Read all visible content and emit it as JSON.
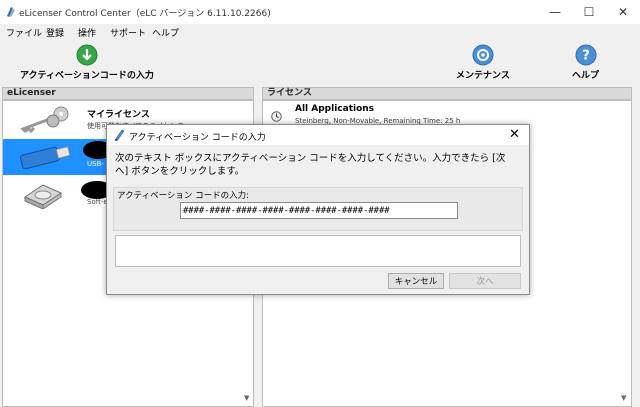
{
  "window": {
    "title": "eLicenser Control Center（eLC バージョン 6.11.10.2266)",
    "min": "—",
    "max": "☐",
    "close": "✕"
  },
  "menu": [
    "ファイル",
    "登録",
    "操作",
    "サポート",
    "ヘルプ"
  ],
  "toolbar": {
    "activation_label": "アクティベーションコードの入力",
    "maintenance_label": "メンテナンス",
    "help_label": "ヘルプ"
  },
  "left_panel": {
    "header": "eLicenser",
    "items": [
      {
        "name": "マイライセンス",
        "sub": "使用可能なすべてのライセンス",
        "icon": "keys-icon"
      },
      {
        "name": "",
        "sub": "USB-",
        "icon": "usb-stick-icon"
      },
      {
        "name": "",
        "sub": "Soft-e",
        "icon": "hard-drive-icon"
      }
    ]
  },
  "right_panel": {
    "header": "ライセンス",
    "license": {
      "name": "All Applications",
      "detail": "Steinberg, Non-Movable, Remaining Time: 25 h",
      "icon": "clock-icon"
    }
  },
  "dialog": {
    "title": "アクティベーション コードの入力",
    "instruction": "次のテキスト ボックスにアクティベーション コードを入力してください。入力できたら [次へ] ボタンをクリックします。",
    "field_label": "アクティベーション コードの入力:",
    "code_value": "####-####-####-####-####-####-####-####",
    "cancel_label": "キャンセル",
    "next_label": "次へ"
  },
  "colors": {
    "selection": "#1e90ff",
    "panel_header": "#d9d9d9",
    "dialog_bg": "#f0f0f0"
  }
}
